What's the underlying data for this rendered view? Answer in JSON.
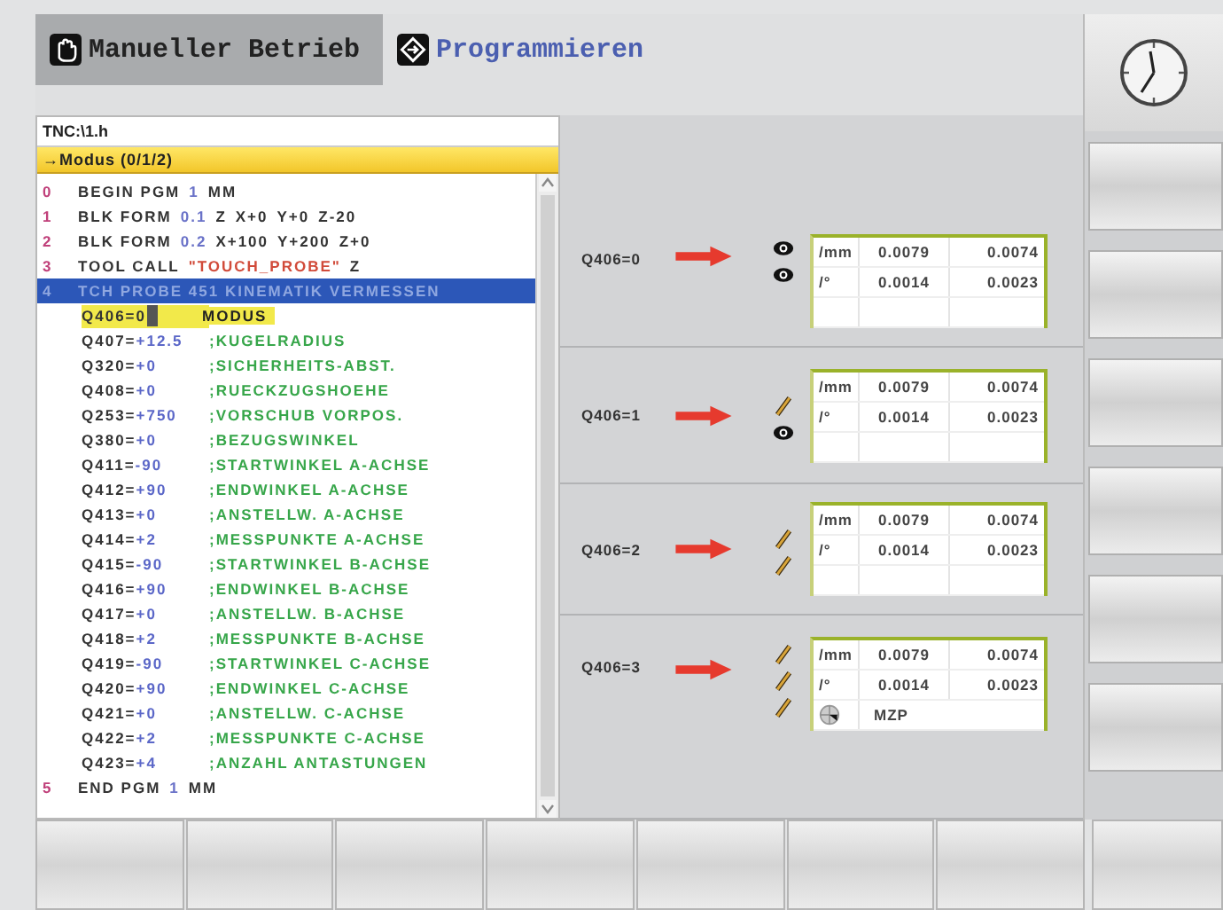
{
  "tabs": [
    {
      "label": "Manueller Betrieb",
      "kind": "manual",
      "selected": false
    },
    {
      "label": "Programmieren",
      "kind": "program",
      "selected": true
    }
  ],
  "program": {
    "path": "TNC:\\1.h",
    "context": "→Modus (0/1/2)",
    "lines": [
      {
        "num": "0",
        "selected": false,
        "parts": [
          {
            "kind": "kw",
            "text": "BEGIN PGM"
          },
          {
            "kind": "num",
            "text": "1"
          },
          {
            "kind": "kw",
            "text": "MM"
          }
        ]
      },
      {
        "num": "1",
        "selected": false,
        "parts": [
          {
            "kind": "kw",
            "text": "BLK FORM"
          },
          {
            "kind": "num",
            "text": "0.1"
          },
          {
            "kind": "kw",
            "text": "Z"
          },
          {
            "kind": "kw",
            "text": "X+0"
          },
          {
            "kind": "kw",
            "text": "Y+0"
          },
          {
            "kind": "kw",
            "text": "Z-20"
          }
        ]
      },
      {
        "num": "2",
        "selected": false,
        "parts": [
          {
            "kind": "kw",
            "text": "BLK FORM"
          },
          {
            "kind": "num",
            "text": "0.2"
          },
          {
            "kind": "kw",
            "text": " X+100"
          },
          {
            "kind": "kw",
            "text": " Y+200"
          },
          {
            "kind": "kw",
            "text": " Z+0"
          }
        ]
      },
      {
        "num": "3",
        "selected": false,
        "parts": [
          {
            "kind": "kw",
            "text": "TOOL CALL"
          },
          {
            "kind": "str",
            "text": "\"TOUCH_PROBE\""
          },
          {
            "kind": "kw",
            "text": "Z"
          }
        ]
      },
      {
        "num": "4",
        "selected": true,
        "parts": [
          {
            "kind": "kw",
            "text": "TCH PROBE 451 KINEMATIK VERMESSEN"
          }
        ],
        "params": [
          {
            "name": "Q406=0",
            "comment": "MODUS",
            "selected": true
          },
          {
            "name": "Q407=",
            "value": "+12.5",
            "comment": ";KUGELRADIUS",
            "selected": false
          },
          {
            "name": "Q320=",
            "value": "+0",
            "comment": ";SICHERHEITS-ABST.",
            "selected": false
          },
          {
            "name": "Q408=",
            "value": "+0",
            "comment": ";RUECKZUGSHOEHE",
            "selected": false
          },
          {
            "name": "Q253=",
            "value": "+750",
            "comment": ";VORSCHUB VORPOS.",
            "selected": false
          },
          {
            "name": "Q380=",
            "value": "+0",
            "comment": ";BEZUGSWINKEL",
            "selected": false
          },
          {
            "name": "Q411=",
            "value": "-90",
            "comment": ";STARTWINKEL A-ACHSE",
            "selected": false
          },
          {
            "name": "Q412=",
            "value": "+90",
            "comment": ";ENDWINKEL A-ACHSE",
            "selected": false
          },
          {
            "name": "Q413=",
            "value": "+0",
            "comment": ";ANSTELLW. A-ACHSE",
            "selected": false
          },
          {
            "name": "Q414=",
            "value": "+2",
            "comment": ";MESSPUNKTE A-ACHSE",
            "selected": false
          },
          {
            "name": "Q415=",
            "value": "-90",
            "comment": ";STARTWINKEL B-ACHSE",
            "selected": false
          },
          {
            "name": "Q416=",
            "value": "+90",
            "comment": ";ENDWINKEL B-ACHSE",
            "selected": false
          },
          {
            "name": "Q417=",
            "value": "+0",
            "comment": ";ANSTELLW. B-ACHSE",
            "selected": false
          },
          {
            "name": "Q418=",
            "value": "+2",
            "comment": ";MESSPUNKTE B-ACHSE",
            "selected": false
          },
          {
            "name": "Q419=",
            "value": "-90",
            "comment": ";STARTWINKEL C-ACHSE",
            "selected": false
          },
          {
            "name": "Q420=",
            "value": "+90",
            "comment": ";ENDWINKEL C-ACHSE",
            "selected": false
          },
          {
            "name": "Q421=",
            "value": "+0",
            "comment": ";ANSTELLW. C-ACHSE",
            "selected": false
          },
          {
            "name": "Q422=",
            "value": "+2",
            "comment": ";MESSPUNKTE C-ACHSE",
            "selected": false
          },
          {
            "name": "Q423=",
            "value": "+4",
            "comment": ";ANZAHL ANTASTUNGEN",
            "selected": false
          }
        ]
      },
      {
        "num": "5",
        "selected": false,
        "parts": [
          {
            "kind": "kw",
            "text": "END PGM"
          },
          {
            "kind": "num",
            "text": "1"
          },
          {
            "kind": "kw",
            "text": "MM"
          }
        ]
      }
    ]
  },
  "modes": [
    {
      "label": "Q406=0",
      "rows": [
        {
          "kind": "values",
          "editable": false,
          "unit": "/mm",
          "v1": "0.0079",
          "v2": "0.0074"
        },
        {
          "kind": "values",
          "editable": false,
          "unit": "/°",
          "v1": "0.0014",
          "v2": "0.0023"
        }
      ]
    },
    {
      "label": "Q406=1",
      "rows": [
        {
          "kind": "values",
          "editable": true,
          "unit": "/mm",
          "v1": "0.0079",
          "v2": "0.0074"
        },
        {
          "kind": "values",
          "editable": false,
          "unit": "/°",
          "v1": "0.0014",
          "v2": "0.0023"
        }
      ]
    },
    {
      "label": "Q406=2",
      "rows": [
        {
          "kind": "values",
          "editable": true,
          "unit": "/mm",
          "v1": "0.0079",
          "v2": "0.0074"
        },
        {
          "kind": "values",
          "editable": true,
          "unit": "/°",
          "v1": "0.0014",
          "v2": "0.0023"
        }
      ]
    },
    {
      "label": "Q406=3",
      "rows": [
        {
          "kind": "values",
          "editable": true,
          "unit": "/mm",
          "v1": "0.0079",
          "v2": "0.0074"
        },
        {
          "kind": "values",
          "editable": true,
          "unit": "/°",
          "v1": "0.0014",
          "v2": "0.0023"
        },
        {
          "kind": "target",
          "editable": true,
          "v1": "MZP"
        }
      ]
    }
  ]
}
